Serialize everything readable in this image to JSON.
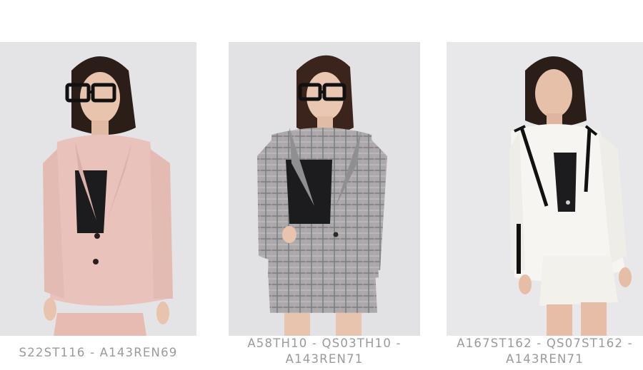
{
  "products": [
    {
      "code": "S22ST116 - A143REN69"
    },
    {
      "code": "A58TH10 - QS03TH10 - A143REN71"
    },
    {
      "code": "A167ST162 - QS07ST162 - A143REN71"
    }
  ],
  "colors": {
    "caption_text": "#9a9a9a",
    "photo_bg": "#e4e4e6",
    "blazer_pink": "#e9c2bb",
    "blazer_plaid": "#a7a6a8",
    "blazer_white": "#f6f5f1",
    "lace_black": "#1c1b1d",
    "hair_dark": "#2b1d17"
  },
  "icons": [
    "model-photo-pink-blazer",
    "model-photo-plaid-blazer",
    "model-photo-white-blazer"
  ]
}
